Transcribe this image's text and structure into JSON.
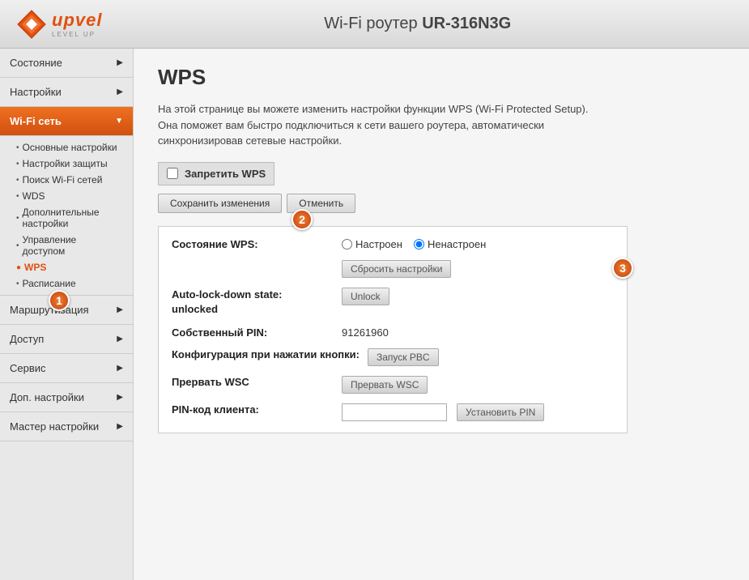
{
  "header": {
    "title_prefix": "Wi-Fi роутер ",
    "title_model": "UR-316N3G"
  },
  "sidebar": {
    "items": [
      {
        "id": "status",
        "label": "Состояние",
        "arrow": "▶",
        "active": false
      },
      {
        "id": "settings",
        "label": "Настройки",
        "arrow": "▶",
        "active": false
      },
      {
        "id": "wifi",
        "label": "Wi-Fi сеть",
        "arrow": "▼",
        "active": true,
        "expanded": true
      },
      {
        "id": "routing",
        "label": "Маршрутизация",
        "arrow": "▶",
        "active": false
      },
      {
        "id": "access",
        "label": "Доступ",
        "arrow": "▶",
        "active": false
      },
      {
        "id": "service",
        "label": "Сервис",
        "arrow": "▶",
        "active": false
      },
      {
        "id": "advanced",
        "label": "Доп. настройки",
        "arrow": "▶",
        "active": false
      },
      {
        "id": "wizard",
        "label": "Мастер настройки",
        "arrow": "▶",
        "active": false
      }
    ],
    "wifi_subitems": [
      {
        "id": "basic",
        "label": "Основные настройки",
        "active": false
      },
      {
        "id": "security",
        "label": "Настройки защиты",
        "active": false
      },
      {
        "id": "scan",
        "label": "Поиск Wi-Fi сетей",
        "active": false
      },
      {
        "id": "wps",
        "label": "WDS",
        "active": false
      },
      {
        "id": "additional",
        "label": "Дополнительные настройки",
        "active": false
      },
      {
        "id": "access_ctrl",
        "label": "Управление доступом",
        "active": false
      },
      {
        "id": "wps_active",
        "label": "WPS",
        "active": true
      },
      {
        "id": "reboot",
        "label": "Расписание",
        "active": false
      }
    ]
  },
  "main": {
    "title": "WPS",
    "description": "На этой странице вы можете изменить настройки функции WPS (Wi-Fi Protected Setup). Она поможет вам быстро подключиться к сети вашего роутера, автоматически синхронизировав сетевые настройки.",
    "disable_wps_label": "Запретить WPS",
    "save_button": "Сохранить изменения",
    "cancel_button": "Отменить",
    "wps_status_label": "Состояние WPS:",
    "wps_configured": "Настроен",
    "wps_not_configured": "Ненастроен",
    "reset_button": "Сбросить настройки",
    "autolock_label": "Auto-lock-down state:",
    "autolock_value": "unlocked",
    "unlock_button": "Unlock",
    "own_pin_label": "Собственный PIN:",
    "own_pin_value": "91261960",
    "config_pbc_label": "Конфигурация при нажатии кнопки:",
    "launch_pbc_button": "Запуск PBC",
    "interrupt_wsc_label": "Прервать WSC",
    "interrupt_wsc_button": "Прервать WSC",
    "client_pin_label": "PIN-код клиента:",
    "set_pin_button": "Установить PIN",
    "callouts": [
      "1",
      "2",
      "3"
    ]
  }
}
